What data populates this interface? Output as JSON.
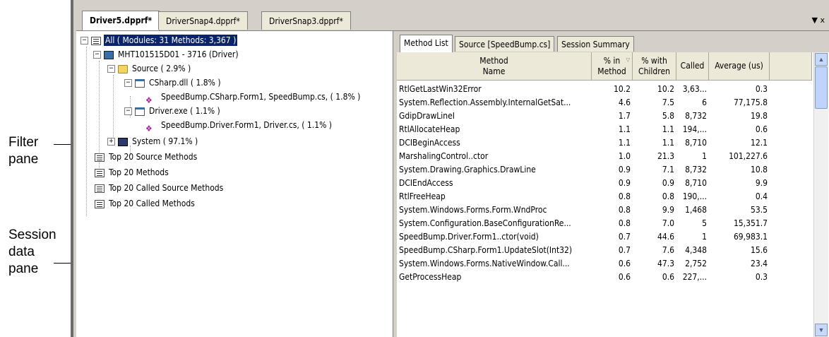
{
  "callouts": {
    "filter_pane": [
      "Filter",
      "pane"
    ],
    "session_pane": [
      "Session",
      "data",
      "pane"
    ]
  },
  "document_tabs": [
    {
      "label": "Driver5.dpprf*",
      "active": true
    },
    {
      "label": "DriverSnap4.dpprf*",
      "active": false
    },
    {
      "label": "DriverSnap3.dpprf*",
      "active": false
    }
  ],
  "tab_overflow_icon": "chevron-down-icon",
  "tree": [
    {
      "label": "All ( Modules: 31 Methods: 3,367 )",
      "icon": "list-icon",
      "expander": "−",
      "selected": true
    },
    {
      "label": "MHT101515D01 - 3716 (Driver)",
      "icon": "computer-icon",
      "expander": "−"
    },
    {
      "label": "Source ( 2.9% )",
      "icon": "folder-icon",
      "expander": "−"
    },
    {
      "label": "CSharp.dll ( 1.8% )",
      "icon": "module-icon",
      "expander": "−"
    },
    {
      "label": "SpeedBump.CSharp.Form1, SpeedBump.cs, ( 1.8% )",
      "icon": "method-icon",
      "expander": ""
    },
    {
      "label": "Driver.exe ( 1.1% )",
      "icon": "module-icon",
      "expander": "−"
    },
    {
      "label": "SpeedBump.Driver.Form1, Driver.cs, ( 1.1% )",
      "icon": "method-icon",
      "expander": ""
    },
    {
      "label": "System ( 97.1% )",
      "icon": "system-icon",
      "expander": "+"
    },
    {
      "label": "Top 20 Source Methods",
      "icon": "list-icon",
      "expander": ""
    },
    {
      "label": "Top 20 Methods",
      "icon": "list-icon",
      "expander": ""
    },
    {
      "label": "Top 20 Called Source Methods",
      "icon": "list-icon",
      "expander": ""
    },
    {
      "label": "Top 20 Called Methods",
      "icon": "list-icon",
      "expander": ""
    }
  ],
  "session_tabs": [
    {
      "label": "Method List",
      "active": true
    },
    {
      "label": "Source [SpeedBump.cs]",
      "active": false
    },
    {
      "label": "Session Summary",
      "active": false
    }
  ],
  "columns": [
    {
      "label": "Method\nName"
    },
    {
      "label": "% in\nMethod",
      "sort_icon": "▽"
    },
    {
      "label": "% with\nChildren"
    },
    {
      "label": "Called"
    },
    {
      "label": "Average (us)"
    }
  ],
  "rows": [
    [
      "RtlGetLastWin32Error",
      "10.2",
      "10.2",
      "3,63...",
      "0.3"
    ],
    [
      "System.Reflection.Assembly.InternalGetSat...",
      "4.6",
      "7.5",
      "6",
      "77,175.8"
    ],
    [
      "GdipDrawLineI",
      "1.7",
      "5.8",
      "8,732",
      "19.8"
    ],
    [
      "RtlAllocateHeap",
      "1.1",
      "1.1",
      "194,...",
      "0.6"
    ],
    [
      "DCIBeginAccess",
      "1.1",
      "1.1",
      "8,710",
      "12.1"
    ],
    [
      "MarshalingControl..ctor",
      "1.0",
      "21.3",
      "1",
      "101,227.6"
    ],
    [
      "System.Drawing.Graphics.DrawLine",
      "0.9",
      "7.1",
      "8,732",
      "10.8"
    ],
    [
      "DCIEndAccess",
      "0.9",
      "0.9",
      "8,710",
      "9.9"
    ],
    [
      "RtlFreeHeap",
      "0.8",
      "0.8",
      "190,...",
      "0.4"
    ],
    [
      "System.Windows.Forms.Form.WndProc",
      "0.8",
      "9.9",
      "1,468",
      "53.5"
    ],
    [
      "System.Configuration.BaseConfigurationRe...",
      "0.8",
      "7.0",
      "5",
      "15,351.7"
    ],
    [
      "SpeedBump.Driver.Form1..ctor(void)",
      "0.7",
      "44.6",
      "1",
      "69,983.1"
    ],
    [
      "SpeedBump.CSharp.Form1.UpdateSlot(Int32)",
      "0.7",
      "7.6",
      "4,348",
      "15.6"
    ],
    [
      "System.Windows.Forms.NativeWindow.Call...",
      "0.6",
      "47.3",
      "2,752",
      "23.4"
    ],
    [
      "GetProcessHeap",
      "0.6",
      "0.6",
      "227,...",
      "0.3"
    ]
  ],
  "scrollbar": {
    "up_icon": "arrow-up-icon",
    "down_icon": "arrow-down-icon"
  }
}
